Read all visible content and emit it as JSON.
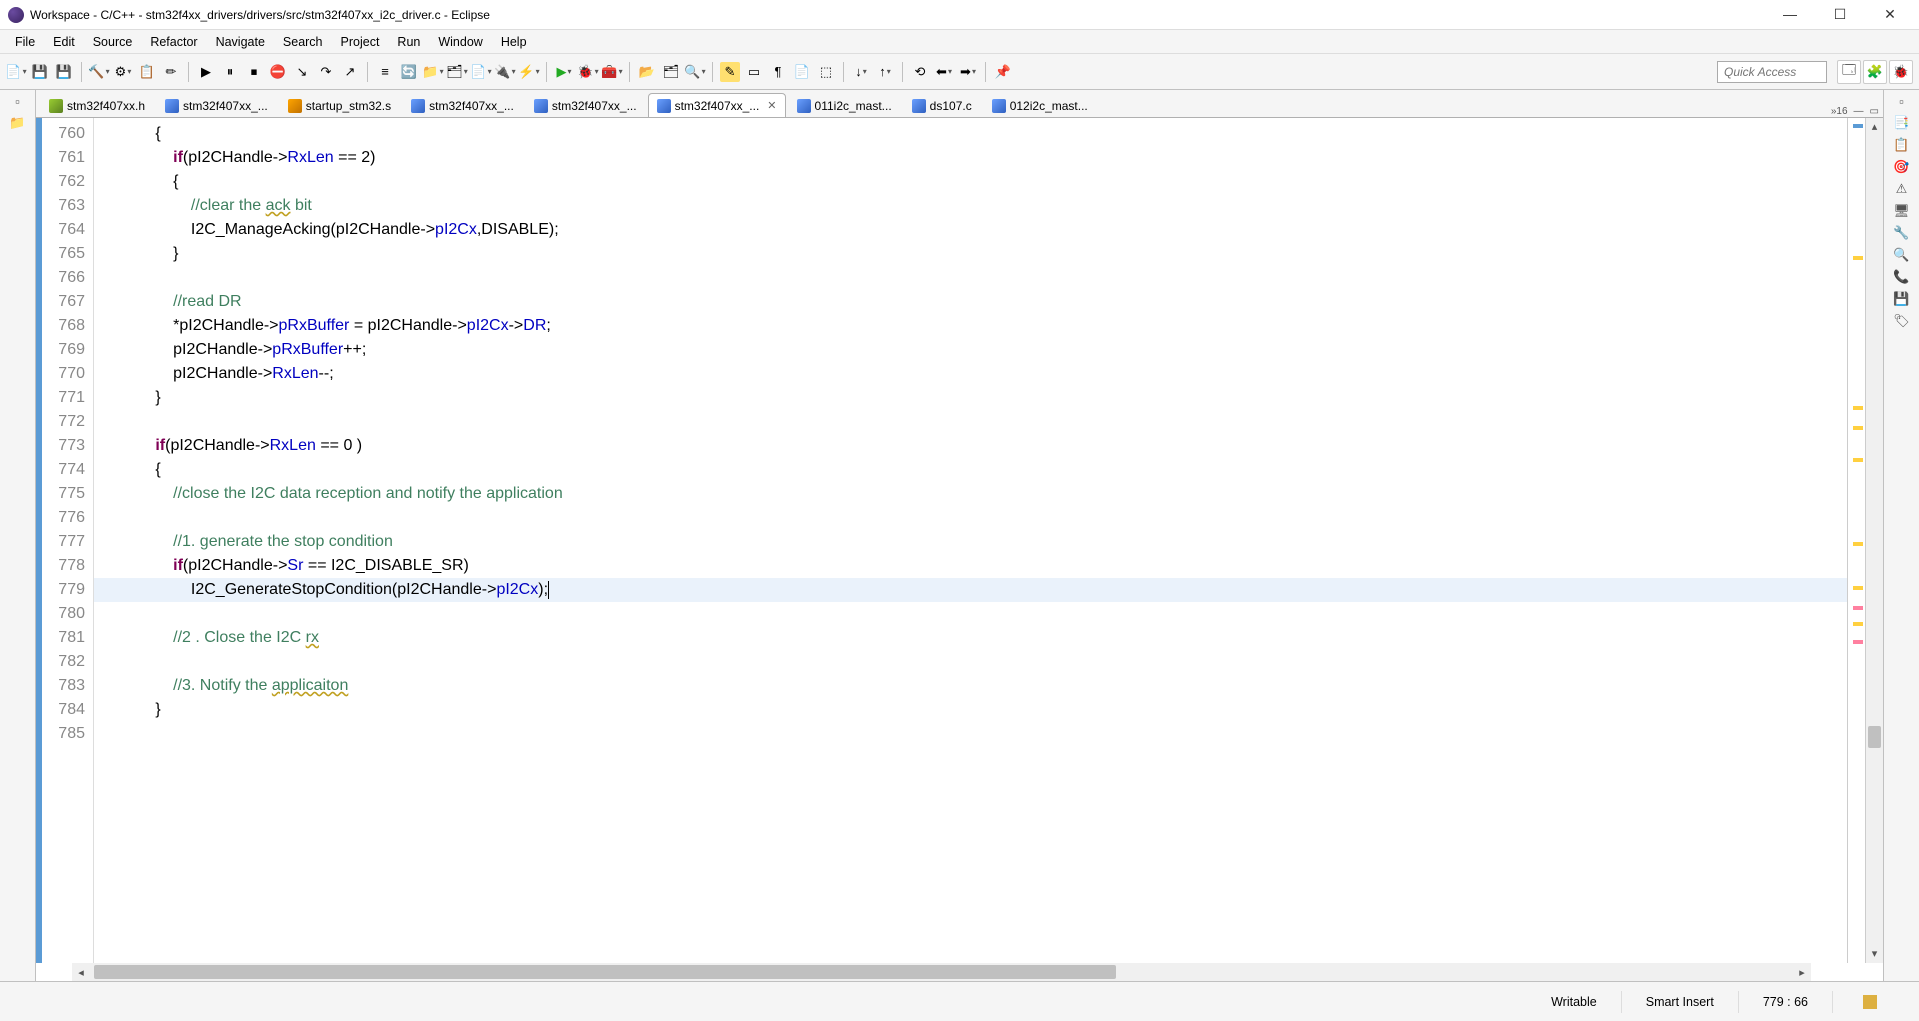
{
  "window": {
    "title": "Workspace - C/C++ - stm32f4xx_drivers/drivers/src/stm32f407xx_i2c_driver.c - Eclipse"
  },
  "menu": {
    "file": "File",
    "edit": "Edit",
    "source": "Source",
    "refactor": "Refactor",
    "navigate": "Navigate",
    "search": "Search",
    "project": "Project",
    "run": "Run",
    "window": "Window",
    "help": "Help"
  },
  "quick_access_placeholder": "Quick Access",
  "tabs_overflow": "»16",
  "tabs": [
    {
      "label": "stm32f407xx.h",
      "icon": "h"
    },
    {
      "label": "stm32f407xx_...",
      "icon": "c"
    },
    {
      "label": "startup_stm32.s",
      "icon": "s"
    },
    {
      "label": "stm32f407xx_...",
      "icon": "c"
    },
    {
      "label": "stm32f407xx_...",
      "icon": "c"
    },
    {
      "label": "stm32f407xx_...",
      "icon": "c",
      "active": true
    },
    {
      "label": "011i2c_mast...",
      "icon": "c"
    },
    {
      "label": "ds107.c",
      "icon": "c"
    },
    {
      "label": "012i2c_mast...",
      "icon": "c"
    }
  ],
  "line_start": 760,
  "line_end": 785,
  "code_lines": [
    {
      "n": 760,
      "html": "            {"
    },
    {
      "n": 761,
      "html": "                <span class='kw'>if</span>(pI2CHandle-><span class='field'>RxLen</span> == 2)"
    },
    {
      "n": 762,
      "html": "                {"
    },
    {
      "n": 763,
      "html": "                    <span class='cm'>//clear the <span class='sp-underline'>ack</span> bit</span>"
    },
    {
      "n": 764,
      "html": "                    I2C_ManageAcking(pI2CHandle-><span class='field'>pI2Cx</span>,DISABLE);"
    },
    {
      "n": 765,
      "html": "                }"
    },
    {
      "n": 766,
      "html": ""
    },
    {
      "n": 767,
      "html": "                <span class='cm'>//read DR</span>"
    },
    {
      "n": 768,
      "html": "                *pI2CHandle-><span class='field'>pRxBuffer</span> = pI2CHandle-><span class='field'>pI2Cx</span>-><span class='field'>DR</span>;"
    },
    {
      "n": 769,
      "html": "                pI2CHandle-><span class='field'>pRxBuffer</span>++;"
    },
    {
      "n": 770,
      "html": "                pI2CHandle-><span class='field'>RxLen</span>--;"
    },
    {
      "n": 771,
      "html": "            }"
    },
    {
      "n": 772,
      "html": ""
    },
    {
      "n": 773,
      "html": "            <span class='kw'>if</span>(pI2CHandle-><span class='field'>RxLen</span> == 0 )"
    },
    {
      "n": 774,
      "html": "            {"
    },
    {
      "n": 775,
      "html": "                <span class='cm'>//close the I2C data reception and notify the application</span>"
    },
    {
      "n": 776,
      "html": ""
    },
    {
      "n": 777,
      "html": "                <span class='cm'>//1. generate the stop condition</span>"
    },
    {
      "n": 778,
      "html": "                <span class='kw'>if</span>(pI2CHandle-><span class='field'>Sr</span> == I2C_DISABLE_SR)"
    },
    {
      "n": 779,
      "html": "                    I2C_GenerateStopCondition(pI2CHandle-><span class='field'>pI2Cx</span>);<span class='cursor'></span>",
      "hl": true
    },
    {
      "n": 780,
      "html": ""
    },
    {
      "n": 781,
      "html": "                <span class='cm'>//2 . Close the I2C <span class='sp-underline'>rx</span></span>"
    },
    {
      "n": 782,
      "html": ""
    },
    {
      "n": 783,
      "html": "                <span class='cm'>//3. Notify the <span class='sp-underline'>applicaiton</span></span>"
    },
    {
      "n": 784,
      "html": "            }"
    },
    {
      "n": 785,
      "html": ""
    }
  ],
  "status": {
    "writable": "Writable",
    "insert": "Smart Insert",
    "pos": "779 : 66"
  }
}
